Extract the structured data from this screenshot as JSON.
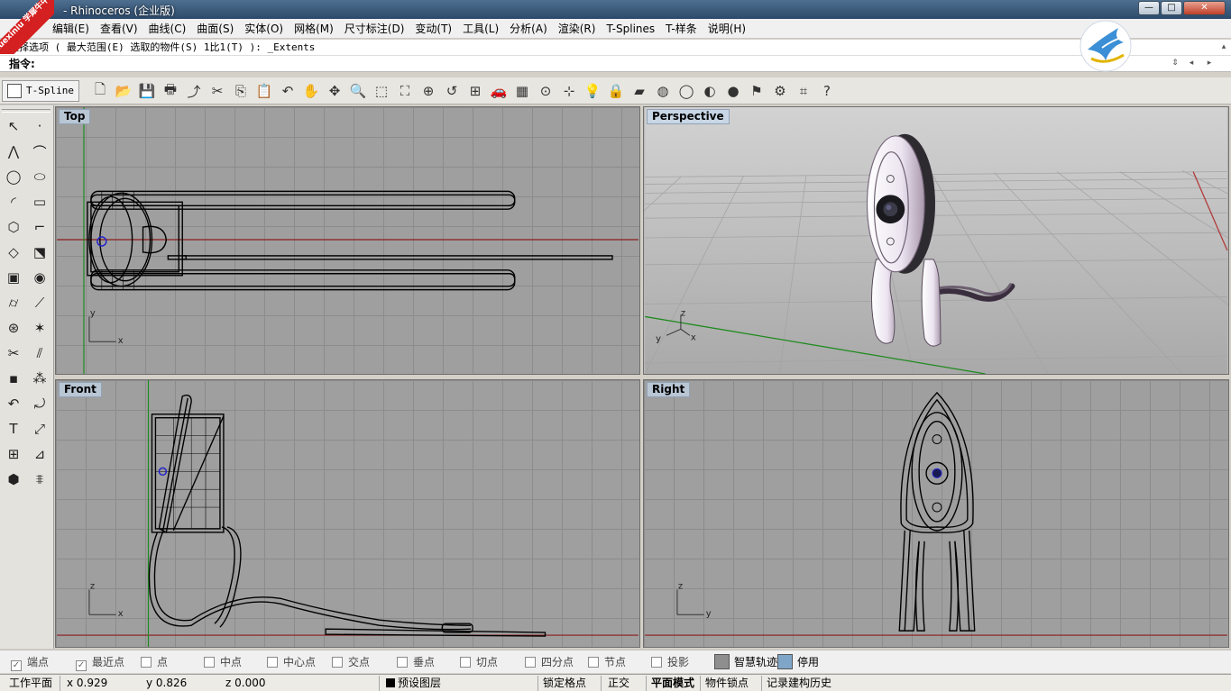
{
  "window": {
    "title": "- Rhinoceros (企业版)",
    "logo_text": "xuexiniu 学犀牛中文网",
    "min_symbol": "—",
    "max_symbol": "□",
    "close_symbol": "✕"
  },
  "menu": {
    "items": [
      "编辑(E)",
      "查看(V)",
      "曲线(C)",
      "曲面(S)",
      "实体(O)",
      "网格(M)",
      "尺寸标注(D)",
      "变动(T)",
      "工具(L)",
      "分析(A)",
      "渲染(R)",
      "T-Splines",
      "T-样条",
      "说明(H)"
    ]
  },
  "command": {
    "history_line": "选择选项 ( 最大范围(E)  选取的物件(S)  1比1(T) ): _Extents",
    "prompt_label": "指令:",
    "input_value": ""
  },
  "toolbar": {
    "tab_label": "T-Spline",
    "tools": [
      "new-file-icon",
      "open-file-icon",
      "save-icon",
      "print-icon",
      "import-icon",
      "cut-icon",
      "copy-icon",
      "paste-icon",
      "undo-icon",
      "pan-hand-icon",
      "rotate-view-icon",
      "zoom-icon",
      "zoom-window-icon",
      "zoom-extents-icon",
      "zoom-selected-icon",
      "undo-view-icon",
      "four-viewports-icon",
      "car-icon",
      "plane-grid-icon",
      "cplane-icon",
      "osnap-icon",
      "light-icon",
      "lock-icon",
      "layer-icon",
      "color-wheel-icon",
      "wireframe-sphere-icon",
      "shaded-sphere-icon",
      "rendered-sphere-icon",
      "flag-icon",
      "settings-gear-icon",
      "grid-snap-icon",
      "help-icon"
    ],
    "tool_glyphs": [
      "🗋",
      "📂",
      "💾",
      "🖶",
      "⤴",
      "✂",
      "⎘",
      "📋",
      "↶",
      "✋",
      "✥",
      "🔍",
      "⬚",
      "⛶",
      "⊕",
      "↺",
      "⊞",
      "🚗",
      "▦",
      "⊙",
      "⊹",
      "💡",
      "🔒",
      "▰",
      "◍",
      "◯",
      "◐",
      "●",
      "⚑",
      "⚙",
      "⌗",
      "?"
    ]
  },
  "palette": {
    "tools": [
      "select-arrow-icon",
      "point-icon",
      "polyline-icon",
      "curve-icon",
      "circle-icon",
      "ellipse-icon",
      "arc-icon",
      "rectangle-icon",
      "polygon-icon",
      "fillet-curve-icon",
      "surface-icon",
      "extrude-curve-icon",
      "box-icon",
      "sphere-icon",
      "cylinder-icon",
      "loft-icon",
      "boolean-icon",
      "explode-icon",
      "trim-icon",
      "split-icon",
      "group-icon",
      "array-icon",
      "fillet-icon",
      "rotate-icon",
      "text-icon",
      "scale-icon",
      "transform-icon",
      "dimension-icon",
      "solid-icon",
      "hatch-icon"
    ],
    "glyphs": [
      "↖",
      "·",
      "⋀",
      "⌒",
      "◯",
      "⬭",
      "◜",
      "▭",
      "⬡",
      "⌐",
      "◇",
      "⬔",
      "▣",
      "◉",
      "⌭",
      "⟋",
      "⊛",
      "✶",
      "✂",
      "⫽",
      "▪",
      "⁂",
      "↶",
      "⤾",
      "T",
      "⤢",
      "⊞",
      "⊿",
      "⬢",
      "⩨"
    ]
  },
  "viewports": {
    "top": {
      "label": "Top",
      "axis_a": "y",
      "axis_b": "x"
    },
    "perspective": {
      "label": "Perspective",
      "axis_a": "z",
      "axis_b": "x",
      "axis_c": "y"
    },
    "front": {
      "label": "Front",
      "axis_a": "z",
      "axis_b": "x"
    },
    "right": {
      "label": "Right",
      "axis_a": "z",
      "axis_b": "y"
    }
  },
  "osnaps": [
    {
      "label": "端点",
      "checked": true
    },
    {
      "label": "最近点",
      "checked": true
    },
    {
      "label": "点",
      "checked": false
    },
    {
      "label": "中点",
      "checked": false
    },
    {
      "label": "中心点",
      "checked": false
    },
    {
      "label": "交点",
      "checked": false
    },
    {
      "label": "垂点",
      "checked": false
    },
    {
      "label": "切点",
      "checked": false
    },
    {
      "label": "四分点",
      "checked": false
    },
    {
      "label": "节点",
      "checked": false
    },
    {
      "label": "投影",
      "checked": false
    }
  ],
  "osnap_toggles": {
    "smart_track": "智慧轨迹",
    "disable": "停用"
  },
  "status": {
    "cplane": "工作平面",
    "x": "x 0.929",
    "y": "y 0.826",
    "z": "z 0.000",
    "layer": "预设图层",
    "grid_snap": "锁定格点",
    "ortho": "正交",
    "planar": "平面模式",
    "osnap": "物件锁点",
    "history": "记录建构历史"
  },
  "colors": {
    "viewport_bg": "#9f9f9f",
    "grid_line": "#8c8c8c",
    "x_axis": "#8b1a1a",
    "y_axis": "#1f8a1f",
    "model_wire": "#000000",
    "model_shaded": "#e9e1ec"
  }
}
